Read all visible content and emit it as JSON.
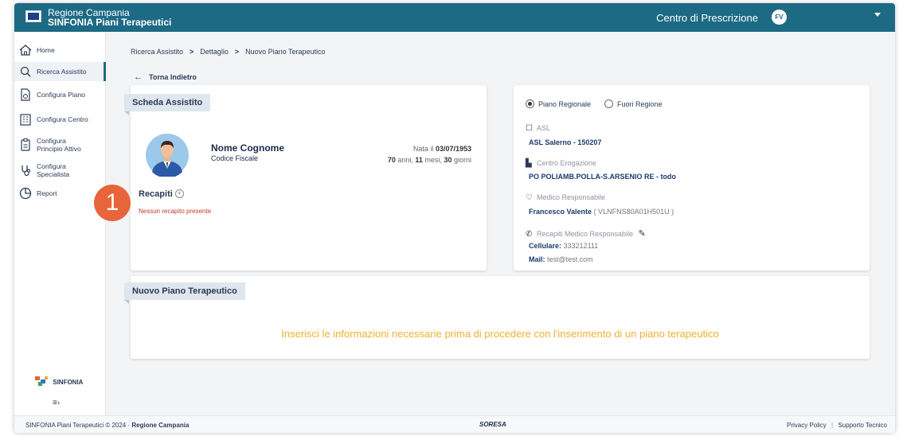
{
  "header": {
    "region": "Regione Campania",
    "app_name": "SINFONIA Piani Terapeutici",
    "center": "Centro di Prescrizione",
    "user_initials": "FV"
  },
  "sidebar": {
    "items": [
      {
        "label": "Home",
        "icon": "home-icon"
      },
      {
        "label": "Ricerca Assistito",
        "icon": "search-icon"
      },
      {
        "label": "Configura Piano",
        "icon": "document-icon"
      },
      {
        "label": "Configura Centro",
        "icon": "building-icon"
      },
      {
        "label": "Configura Principio Attivo",
        "icon": "clipboard-icon"
      },
      {
        "label": "Configura Specialista",
        "icon": "stethoscope-icon"
      },
      {
        "label": "Report",
        "icon": "pie-chart-icon"
      }
    ],
    "brand": "SINFONIA"
  },
  "breadcrumb": [
    "Ricerca Assistito",
    "Dettaglio",
    "Nuovo Piano Terapeutico"
  ],
  "back_label": "Torna Indietro",
  "patient_card": {
    "title": "Scheda Assistito",
    "name": "Nome Cognome",
    "fiscal_code": "Codice Fiscale",
    "birth_prefix": "Nata il",
    "birth_date": "03/07/1953",
    "age_years": "70",
    "age_months": "11",
    "age_days": "30",
    "age_years_label": "anni,",
    "age_months_label": "mesi,",
    "age_days_label": "giorni",
    "contacts_label": "Recapiti",
    "no_contacts": "Nessun recapito presente"
  },
  "annotation_badge": "1",
  "plan_info": {
    "radio_regional": "Piano Regionale",
    "radio_outside": "Fuori Regione",
    "asl_label": "ASL",
    "asl_value": "ASL Salerno - 150207",
    "center_label": "Centro Erogazione",
    "center_value": "PO POLIAMB.POLLA-S.ARSENIO RE - todo",
    "doctor_label": "Medico Responsabile",
    "doctor_name": "Francesco Valente",
    "doctor_code": "( VLNFNS80A01H501U )",
    "contacts_label": "Recapiti Medico Responsabile",
    "phone_label": "Cellulare:",
    "phone_value": "333212111",
    "mail_label": "Mail:",
    "mail_value": "test@test.com"
  },
  "new_plan": {
    "title": "Nuovo Piano Terapeutico",
    "message": "Inserisci le informazioni necessarie prima di procedere con l'inserimento di un piano terapeutico"
  },
  "footer": {
    "left_prefix": "SINFONIA Piani Terapeutici © 2024 ·",
    "left_org": "Regione Campania",
    "center_logo": "SORESA",
    "privacy": "Privacy Policy",
    "divider": "|",
    "support": "Supporto Tecnico"
  },
  "colors": {
    "topbar": "#1d6a84",
    "accent_orange": "#e8643a",
    "message_yellow": "#f0b030",
    "error_red": "#c0392b"
  }
}
